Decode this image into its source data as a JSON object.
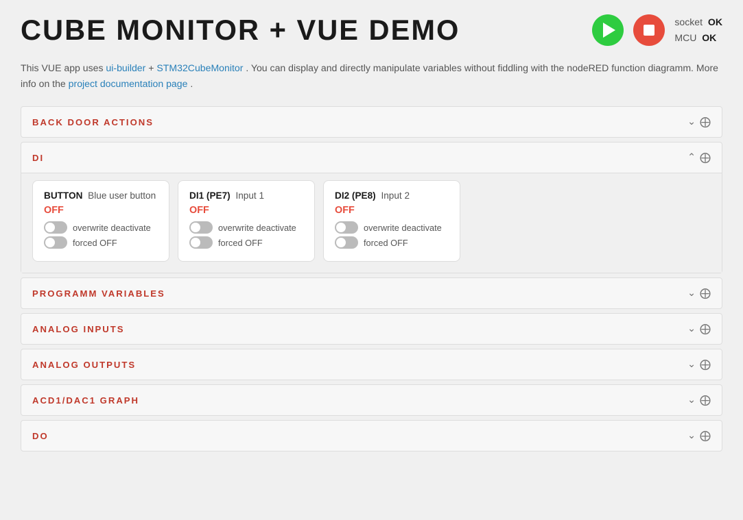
{
  "header": {
    "title": "CUBE MONITOR + VUE DEMO",
    "play_label": "play",
    "stop_label": "stop",
    "socket_label": "socket",
    "socket_status": "OK",
    "mcu_label": "MCU",
    "mcu_status": "OK"
  },
  "intro": {
    "text_pre": "This VUE app uses ",
    "link1": "ui-builder",
    "text_mid1": " + ",
    "link2": "STM32CubeMonitor",
    "text_mid2": ". You can display and directly manipulate variables without fiddling with the nodeRED function diagramm. More info on the ",
    "link3": "project documentation page",
    "text_post": "."
  },
  "sections": [
    {
      "id": "back-door-actions",
      "title": "BACK DOOR ACTIONS",
      "expanded": false,
      "icon_collapse": "⌄",
      "icon_move": "⊹"
    },
    {
      "id": "di",
      "title": "DI",
      "expanded": true,
      "icon_collapse": "⌃",
      "icon_move": "⊹"
    },
    {
      "id": "programm-variables",
      "title": "PROGRAMM VARIABLES",
      "expanded": false,
      "icon_collapse": "⌄",
      "icon_move": "⊹"
    },
    {
      "id": "analog-inputs",
      "title": "ANALOG INPUTS",
      "expanded": false,
      "icon_collapse": "⌄",
      "icon_move": "⊹"
    },
    {
      "id": "analog-outputs",
      "title": "ANALOG OUTPUTS",
      "expanded": false,
      "icon_collapse": "⌄",
      "icon_move": "⊹"
    },
    {
      "id": "acd1-dac1-graph",
      "title": "ACD1/DAC1 GRAPH",
      "expanded": false,
      "icon_collapse": "⌄",
      "icon_move": "⊹"
    },
    {
      "id": "do",
      "title": "DO",
      "expanded": false,
      "icon_collapse": "⌄",
      "icon_move": "⊹"
    }
  ],
  "di_cards": [
    {
      "id": "button",
      "label": "BUTTON",
      "sublabel": "Blue user button",
      "status": "OFF",
      "overwrite_deactivate_label": "overwrite deactivate",
      "forced_off_label": "forced OFF"
    },
    {
      "id": "di1",
      "label": "DI1 (PE7)",
      "sublabel": "Input 1",
      "status": "OFF",
      "overwrite_deactivate_label": "overwrite deactivate",
      "forced_off_label": "forced OFF"
    },
    {
      "id": "di2",
      "label": "DI2 (PE8)",
      "sublabel": "Input 2",
      "status": "OFF",
      "overwrite_deactivate_label": "overwrite deactivate",
      "forced_off_label": "forced OFF"
    }
  ]
}
